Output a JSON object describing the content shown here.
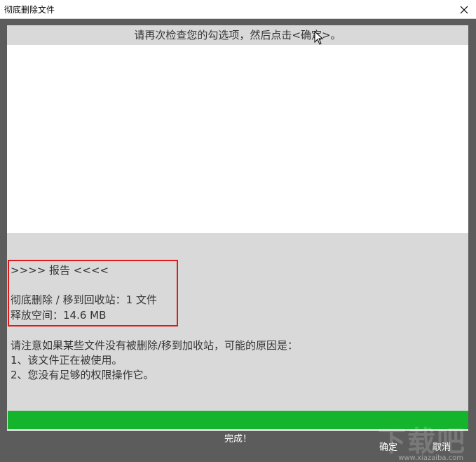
{
  "window": {
    "title": "彻底删除文件",
    "close_icon": "close-icon"
  },
  "header": {
    "instruction": "请再次检查您的勾选项，然后点击<确定>。"
  },
  "report": {
    "heading": ">>>> 报告 <<<<",
    "deleted_line": "彻底删除 / 移到回收站：1 文件",
    "freed_line": "释放空间：14.6 MB"
  },
  "notes": {
    "line1": "请注意如果某些文件没有被删除/移到加收站，可能的原因是：",
    "line2": "1、该文件正在被使用。",
    "line3": "2、您没有足够的权限操作它。"
  },
  "progress": {
    "value": 1.0,
    "color": "#14b42c"
  },
  "status": {
    "text": "完成！"
  },
  "buttons": {
    "ok_label": "确定",
    "cancel_label": "取消"
  },
  "watermark": {
    "text": "下载吧",
    "url": "www.xiazaiba.com"
  },
  "colors": {
    "frame": "#5c5c5c",
    "panel": "#d9d9d9",
    "highlight_border": "#e01a1a"
  }
}
